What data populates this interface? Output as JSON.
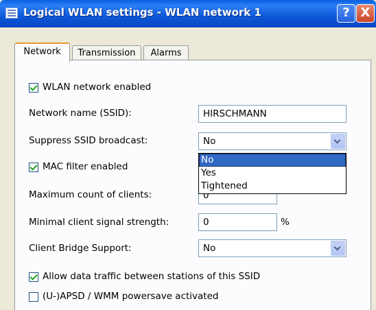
{
  "window": {
    "title": "Logical WLAN settings - WLAN network 1",
    "help_glyph": "?",
    "close_glyph": "X"
  },
  "tabs": [
    {
      "label": "Network",
      "active": true
    },
    {
      "label": "Transmission",
      "active": false
    },
    {
      "label": "Alarms",
      "active": false
    }
  ],
  "form": {
    "wlan_enabled": {
      "label": "WLAN network enabled",
      "checked": true
    },
    "ssid": {
      "label": "Network name (SSID):",
      "value": "HIRSCHMANN"
    },
    "suppress": {
      "label": "Suppress SSID broadcast:",
      "value": "No",
      "options": [
        "No",
        "Yes",
        "Tightened"
      ],
      "selected_index": 0
    },
    "mac_filter": {
      "label": "MAC filter enabled",
      "checked": true
    },
    "max_clients": {
      "label": "Maximum count of clients:",
      "value": "0"
    },
    "min_signal": {
      "label": "Minimal client signal strength:",
      "value": "0",
      "unit": "%"
    },
    "client_bridge": {
      "label": "Client Bridge Support:",
      "value": "No"
    },
    "allow_traffic": {
      "label": "Allow data traffic between stations of this SSID",
      "checked": true
    },
    "apsd": {
      "label": "(U-)APSD / WMM powersave activated",
      "checked": false
    }
  }
}
